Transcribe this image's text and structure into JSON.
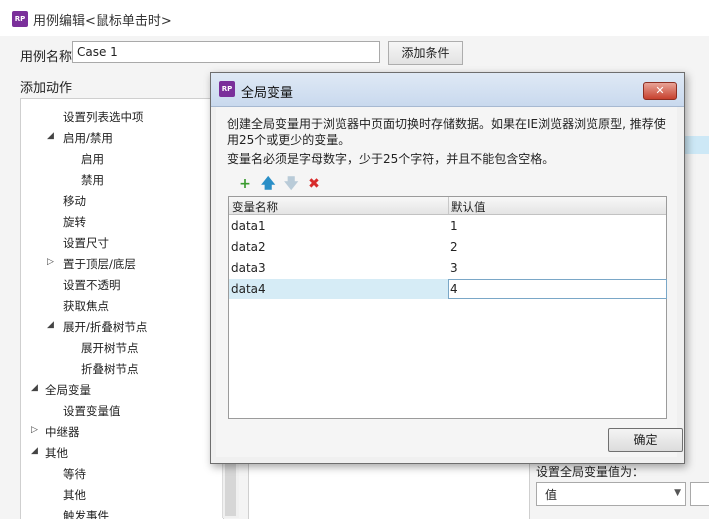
{
  "outer": {
    "title": "用例编辑<鼠标单击时>",
    "logo": "RP",
    "case_name_label": "用例名称",
    "case_name_value": "Case 1",
    "add_condition_label": "添加条件",
    "add_action_label": "添加动作",
    "tree": [
      {
        "label": "设置列表选中项",
        "level": 2,
        "toggle": ""
      },
      {
        "label": "启用/禁用",
        "level": 2,
        "toggle": "◢"
      },
      {
        "label": "启用",
        "level": 3,
        "toggle": ""
      },
      {
        "label": "禁用",
        "level": 3,
        "toggle": ""
      },
      {
        "label": "移动",
        "level": 2,
        "toggle": ""
      },
      {
        "label": "旋转",
        "level": 2,
        "toggle": ""
      },
      {
        "label": "设置尺寸",
        "level": 2,
        "toggle": ""
      },
      {
        "label": "置于顶层/底层",
        "level": 2,
        "toggle": "▷"
      },
      {
        "label": "设置不透明",
        "level": 2,
        "toggle": ""
      },
      {
        "label": "获取焦点",
        "level": 2,
        "toggle": ""
      },
      {
        "label": "展开/折叠树节点",
        "level": 2,
        "toggle": "◢"
      },
      {
        "label": "展开树节点",
        "level": 3,
        "toggle": ""
      },
      {
        "label": "折叠树节点",
        "level": 3,
        "toggle": ""
      },
      {
        "label": "全局变量",
        "level": 1,
        "toggle": "◢"
      },
      {
        "label": "设置变量值",
        "level": 2,
        "toggle": ""
      },
      {
        "label": "中继器",
        "level": 1,
        "toggle": "▷"
      },
      {
        "label": "其他",
        "level": 1,
        "toggle": "◢"
      },
      {
        "label": "等待",
        "level": 2,
        "toggle": ""
      },
      {
        "label": "其他",
        "level": 2,
        "toggle": ""
      },
      {
        "label": "触发事件",
        "level": 2,
        "toggle": ""
      }
    ],
    "set_var_label": "设置全局变量值为：",
    "value_select": "值"
  },
  "dialog": {
    "title": "全局变量",
    "logo": "RP",
    "close_label": "✕",
    "desc_line1": "创建全局变量用于浏览器中页面切换时存储数据。如果在IE浏览器浏览原型, 推荐使用25个或更少的变量。",
    "desc_line2": "变量名必须是字母数字，少于25个字符，并且不能包含空格。",
    "toolbar": {
      "add_icon": "+",
      "up_icon": "🡅",
      "down_icon": "🡇",
      "delete_icon": "✖"
    },
    "columns": [
      "变量名称",
      "默认值"
    ],
    "rows": [
      {
        "name": "data1",
        "value": "1"
      },
      {
        "name": "data2",
        "value": "2"
      },
      {
        "name": "data3",
        "value": "3"
      },
      {
        "name": "data4",
        "value": "4"
      }
    ],
    "ok_label": "确定"
  },
  "colors": {
    "logo": "#7a2f9a",
    "selected_row": "#d6ecf6",
    "close_button": "#c7412e",
    "add_icon": "#3a9b2f",
    "up_icon": "#2a8fc7",
    "delete_icon": "#d72b2b"
  }
}
